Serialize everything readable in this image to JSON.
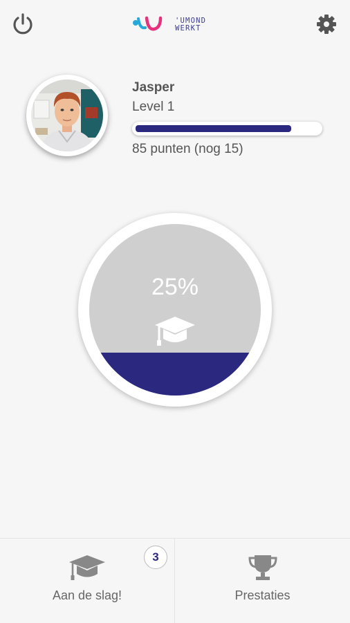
{
  "header": {
    "logo_line1": "'UMOND",
    "logo_line2": "WERKT",
    "power_icon": "power-icon",
    "settings_icon": "gear-icon"
  },
  "profile": {
    "name": "Jasper",
    "level": "Level 1",
    "points_text": "85 punten (nog 15)",
    "progress_fraction": 0.85
  },
  "gauge": {
    "percent_label": "25%",
    "fill_fraction": 0.25,
    "icon": "graduation-cap-icon"
  },
  "nav": {
    "left": {
      "label": "Aan de slag!",
      "icon": "graduation-cap-icon",
      "badge": "3"
    },
    "right": {
      "label": "Prestaties",
      "icon": "trophy-icon"
    }
  },
  "colors": {
    "accent": "#2b2880",
    "brand_pink": "#e6317c",
    "brand_cyan": "#26a8d8",
    "gauge_bg": "#cfcfcf",
    "background": "#f6f6f6"
  }
}
